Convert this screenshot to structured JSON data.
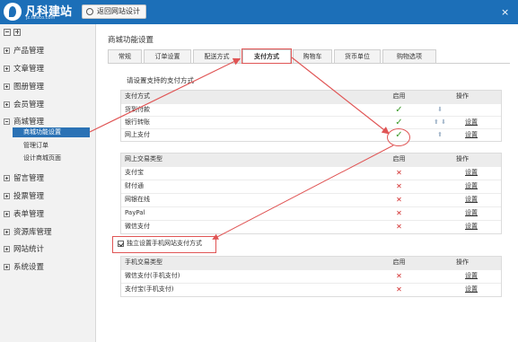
{
  "header": {
    "brand": "凡科建站",
    "brand_sub": "jz.faisco.com",
    "back_button": "返回网站设计",
    "close": "×"
  },
  "sidebar": {
    "items": [
      {
        "label": "产品管理",
        "expanded": false
      },
      {
        "label": "文章管理",
        "expanded": false
      },
      {
        "label": "图册管理",
        "expanded": false
      },
      {
        "label": "会员管理",
        "expanded": false
      },
      {
        "label": "商城管理",
        "expanded": true
      },
      {
        "label": "留言管理",
        "expanded": false
      },
      {
        "label": "投票管理",
        "expanded": false
      },
      {
        "label": "表单管理",
        "expanded": false
      },
      {
        "label": "资源库管理",
        "expanded": false
      },
      {
        "label": "网站统计",
        "expanded": false
      },
      {
        "label": "系统设置",
        "expanded": false
      }
    ],
    "subitems": [
      {
        "label": "商城功能设置",
        "active": true
      },
      {
        "label": "管理订单",
        "active": false
      },
      {
        "label": "设计商城页面",
        "active": false
      }
    ]
  },
  "main": {
    "title": "商城功能设置",
    "tabs": [
      {
        "label": "常规",
        "active": false
      },
      {
        "label": "订单设置",
        "active": false
      },
      {
        "label": "配送方式",
        "active": false
      },
      {
        "label": "支付方式",
        "active": true
      },
      {
        "label": "购物车",
        "active": false
      },
      {
        "label": "货币单位",
        "active": false
      },
      {
        "label": "购物选项",
        "active": false
      }
    ],
    "section_caption": "请设置支持的支付方式",
    "payment_table": {
      "headers": [
        "支付方式",
        "启用",
        "操作"
      ],
      "rows": [
        {
          "name": "货到付款",
          "enabled": true,
          "arrows": "down",
          "action": ""
        },
        {
          "name": "银行转账",
          "enabled": true,
          "arrows": "both",
          "action": "设置"
        },
        {
          "name": "网上支付",
          "enabled": true,
          "arrows": "up",
          "action": "设置"
        }
      ]
    },
    "online_table": {
      "headers": [
        "网上交易类型",
        "启用",
        "操作"
      ],
      "rows": [
        {
          "name": "支付宝",
          "enabled": false,
          "action": "设置"
        },
        {
          "name": "财付通",
          "enabled": false,
          "action": "设置"
        },
        {
          "name": "网银在线",
          "enabled": false,
          "action": "设置"
        },
        {
          "name": "PayPal",
          "enabled": false,
          "action": "设置"
        },
        {
          "name": "微信支付",
          "enabled": false,
          "action": "设置"
        }
      ]
    },
    "mobile_option": {
      "label": "独立设置手机网站支付方式",
      "checked": true
    },
    "mobile_table": {
      "headers": [
        "手机交易类型",
        "启用",
        "操作"
      ],
      "rows": [
        {
          "name": "微信支付(手机支付)",
          "enabled": false,
          "action": "设置"
        },
        {
          "name": "支付宝(手机支付)",
          "enabled": false,
          "action": "设置"
        }
      ]
    }
  },
  "colors": {
    "topbar": "#1c6fb8",
    "active_nav": "#2b72b5",
    "annotation": "#e05555",
    "check": "#3a9a28",
    "cross": "#d12a2a"
  }
}
